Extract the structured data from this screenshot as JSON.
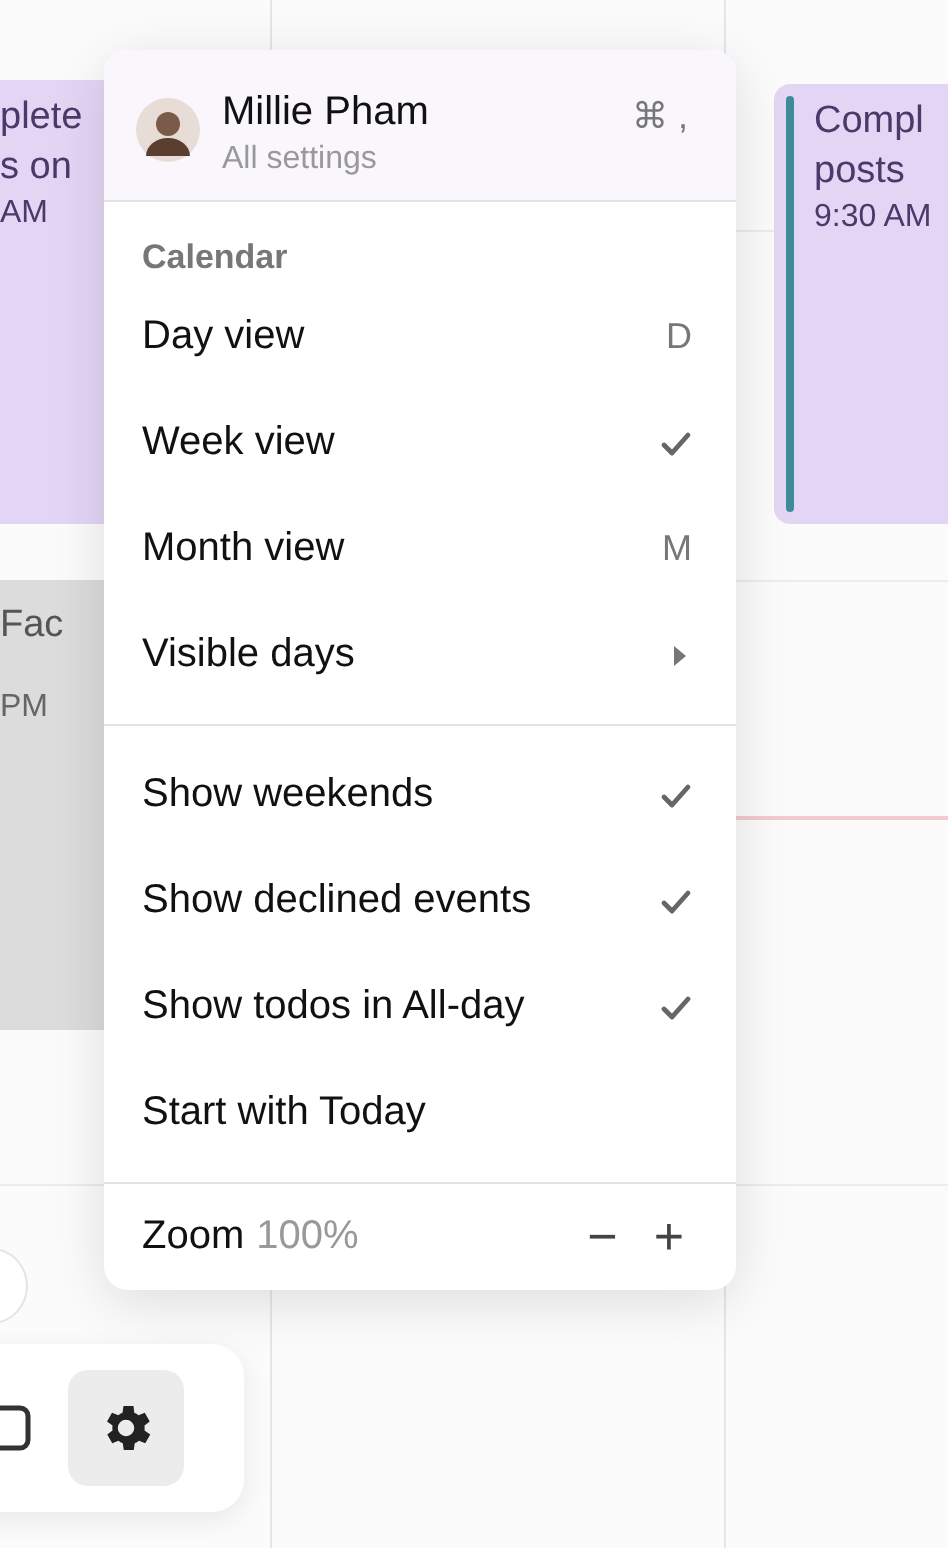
{
  "calendar": {
    "events": [
      {
        "lines": [
          "plete",
          "s on",
          "AM"
        ],
        "color": "#e3d6f5",
        "kind": "plain"
      },
      {
        "lines": [
          "Compl",
          "posts",
          "9:30 AM"
        ],
        "color": "#e3d6f5",
        "kind": "accented"
      },
      {
        "lines": [
          "Fac",
          "PM"
        ],
        "color": "#dcdcdc",
        "kind": "plain"
      }
    ]
  },
  "menu": {
    "profile": {
      "name": "Millie Pham",
      "subtitle": "All settings",
      "shortcut": "⌘ ,"
    },
    "sections": [
      {
        "heading": "Calendar",
        "items": [
          {
            "label": "Day view",
            "kind": "shortcut",
            "shortcut": "D"
          },
          {
            "label": "Week view",
            "kind": "check",
            "checked": true
          },
          {
            "label": "Month view",
            "kind": "shortcut",
            "shortcut": "M"
          },
          {
            "label": "Visible days",
            "kind": "submenu"
          }
        ]
      },
      {
        "items": [
          {
            "label": "Show weekends",
            "kind": "check",
            "checked": true
          },
          {
            "label": "Show declined events",
            "kind": "check",
            "checked": true
          },
          {
            "label": "Show todos in All-day",
            "kind": "check",
            "checked": true
          },
          {
            "label": "Start with Today",
            "kind": "check",
            "checked": false
          }
        ]
      }
    ],
    "zoom": {
      "label": "Zoom",
      "value": "100%",
      "minus": "−",
      "plus": "+"
    }
  },
  "toolbar": {
    "settings_selected": true
  }
}
